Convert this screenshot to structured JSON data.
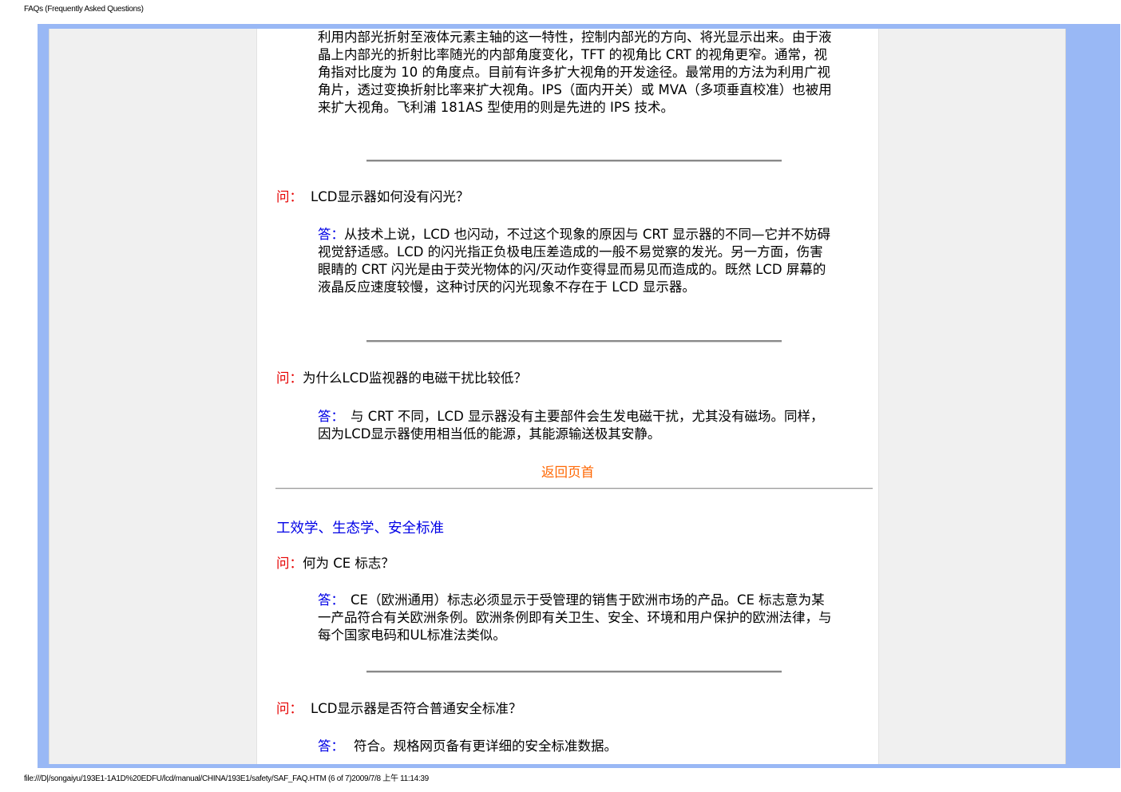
{
  "header": {
    "title": "FAQs (Frequently Asked Questions)"
  },
  "footer": {
    "path": "file:///D|/songaiyu/193E1-1A1D%20EDFU/lcd/manual/CHINA/193E1/safety/SAF_FAQ.HTM (6 of 7)2009/7/8 上午 11:14:39"
  },
  "intro": {
    "answer_text": "利用内部光折射至液体元素主轴的这一特性，控制内部光的方向、将光显示出来。由于液晶上内部光的折射比率随光的内部角度变化，TFT 的视角比 CRT 的视角更窄。通常，视角指对比度为 10 的角度点。目前有许多扩大视角的开发途径。最常用的方法为利用广视角片，透过变换折射比率来扩大视角。IPS（面内开关）或 MVA（多项垂直校准）也被用来扩大视角。飞利浦 181AS 型使用的则是先进的 IPS 技术。"
  },
  "qa1": {
    "q_label": "问：",
    "q_text": "LCD显示器如何没有闪光？",
    "a_label": "答：",
    "a_text": "从技术上说，LCD 也闪动，不过这个现象的原因与 CRT 显示器的不同—它并不妨碍视觉舒适感。LCD 的闪光指正负极电压差造成的一般不易觉察的发光。另一方面，伤害眼睛的 CRT 闪光是由于荧光物体的闪/灭动作变得显而易见而造成的。既然 LCD 屏幕的液晶反应速度较慢，这种讨厌的闪光现象不存在于 LCD 显示器。"
  },
  "qa2": {
    "q_label": "问：",
    "q_text": "为什么LCD监视器的电磁干扰比较低？",
    "a_label": "答：",
    "a_text": "与 CRT 不同，LCD 显示器没有主要部件会生发电磁干扰，尤其没有磁场。同样，因为LCD显示器使用相当低的能源，其能源输送极其安静。"
  },
  "back_to_top": "返回页首",
  "section": {
    "title": "工效学、生态学、安全标准"
  },
  "qa3": {
    "q_label": "问：",
    "q_text": "何为 CE 标志？",
    "a_label": "答：",
    "a_text": "CE（欧洲通用）标志必须显示于受管理的销售于欧洲市场的产品。CE 标志意为某一产品符合有关欧洲条例。欧洲条例即有关卫生、安全、环境和用户保护的欧洲法律，与每个国家电码和UL标准法类似。"
  },
  "qa4": {
    "q_label": "问：",
    "q_text": "LCD显示器是否符合普通安全标准？",
    "a_label": "答：",
    "a_text": "符合。规格网页备有更详细的安全标准数据。"
  },
  "colors": {
    "frame_blue": "#99b8f5",
    "question_red": "#e60000",
    "answer_blue": "#0000e6",
    "link_orange": "#ff6600"
  }
}
